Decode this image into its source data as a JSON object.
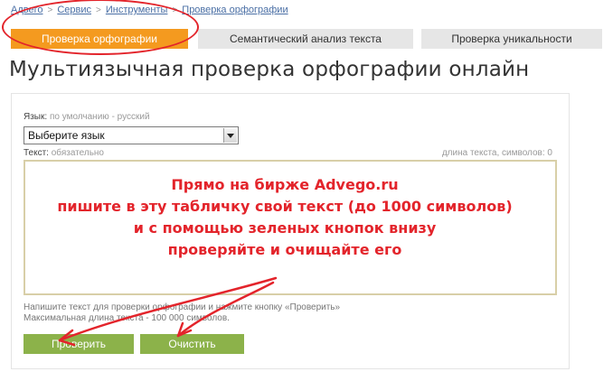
{
  "breadcrumb": {
    "items": [
      "Адвего",
      "Сервис",
      "Инструменты"
    ],
    "current": "Проверка орфографии",
    "separator": ">"
  },
  "tabs": [
    {
      "label": "Проверка орфографии",
      "active": true
    },
    {
      "label": "Семантический анализ текста",
      "active": false
    },
    {
      "label": "Проверка уникальности",
      "active": false
    }
  ],
  "page_title": "Мультиязычная проверка орфографии онлайн",
  "form": {
    "language_label": "Язык:",
    "language_hint": "по умолчанию - русский",
    "language_select_value": "Выберите язык",
    "text_label": "Текст:",
    "text_hint": "обязательно",
    "length_label": "длина текста, символов: 0",
    "note_line1": "Напишите текст для проверки орфографии и нажмите кнопку «Проверить»",
    "note_line2": "Максимальная длина текста - 100 000 символов.",
    "check_button": "Проверить",
    "clear_button": "Очистить"
  },
  "annotation": {
    "lines": [
      "Прямо на бирже Advego.ru",
      "пишите в эту табличку  свой текст (до 1000 символов)",
      "и с помощью зеленых кнопок внизу",
      "проверяйте и очищайте его"
    ]
  },
  "colors": {
    "active_tab": "#f49a1f",
    "inactive_tab": "#e6e6e6",
    "button_green": "#8cb24a",
    "annotation_red": "#e3242b",
    "link_blue": "#4a6fa5"
  }
}
